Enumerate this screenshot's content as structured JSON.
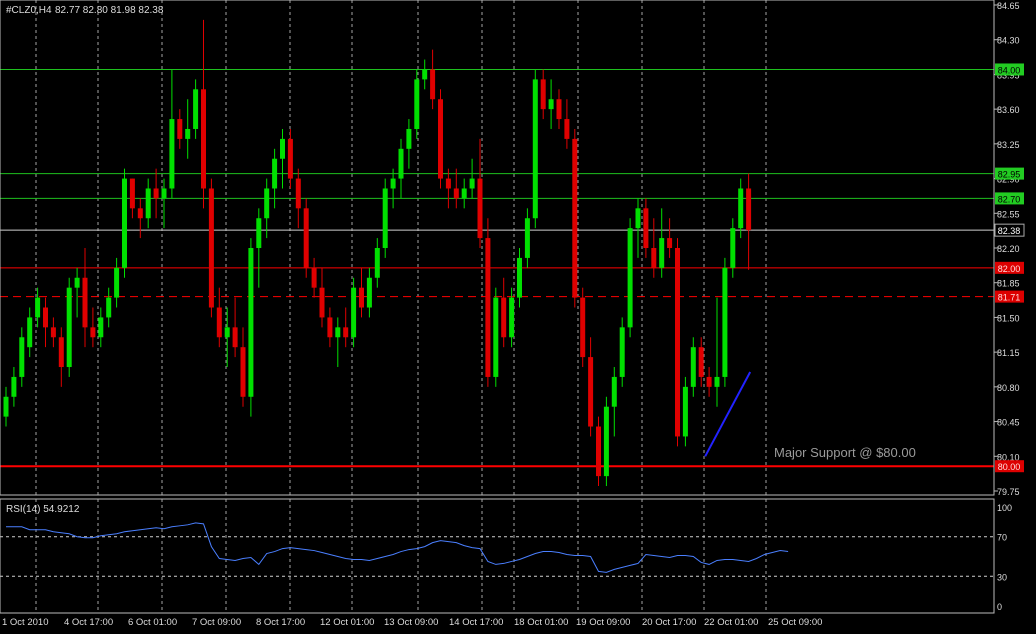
{
  "header": {
    "symbol": "#CLZ0,H4",
    "ohlc": "82.77 82.80 81.98 82.38"
  },
  "rsi": {
    "label": "RSI(14) 54.9212",
    "levels": [
      70,
      30
    ],
    "scale_labels": [
      "100",
      "70",
      "30",
      "0"
    ],
    "ylim": [
      0,
      100
    ]
  },
  "annotation": {
    "text": "Major Support @ $80.00"
  },
  "colors": {
    "background": "#000000",
    "bull": "#00e000",
    "bear": "#e00000",
    "grid": "#cfcfcf",
    "axis_text": "#dddddd",
    "support_line": "#ff0000",
    "resistance_line": "#1ec01e",
    "current_price_line": "#d0d0d0",
    "rsi_line": "#4a7fff",
    "trend_line": "#2222ff",
    "annotation_text": "#9a9a9a"
  },
  "chart_data": {
    "type": "candlestick",
    "title": "#CLZ0,H4",
    "ylim": [
      79.62,
      84.7
    ],
    "y_ticks": [
      "84.65",
      "84.30",
      "83.95",
      "83.60",
      "83.25",
      "82.90",
      "82.55",
      "82.20",
      "81.85",
      "81.50",
      "81.15",
      "80.80",
      "80.45",
      "80.10",
      "79.75"
    ],
    "x_ticks": [
      "1 Oct 2010",
      "4 Oct 17:00",
      "6 Oct 01:00",
      "7 Oct 09:00",
      "8 Oct 17:00",
      "12 Oct 01:00",
      "13 Oct 09:00",
      "14 Oct 17:00",
      "18 Oct 01:00",
      "19 Oct 09:00",
      "20 Oct 17:00",
      "22 Oct 01:00",
      "25 Oct 09:00"
    ],
    "grid": "vertical dashed",
    "horizontal_levels": [
      {
        "price": 84.0,
        "label": "84.00",
        "kind": "resistance",
        "style": "solid"
      },
      {
        "price": 82.95,
        "label": "82.95",
        "kind": "resistance",
        "style": "solid"
      },
      {
        "price": 82.7,
        "label": "82.70",
        "kind": "resistance",
        "style": "solid"
      },
      {
        "price": 82.38,
        "label": "82.38",
        "kind": "current",
        "style": "solid"
      },
      {
        "price": 82.0,
        "label": "82.00",
        "kind": "support",
        "style": "solid"
      },
      {
        "price": 81.71,
        "label": "81.71",
        "kind": "support",
        "style": "dashed"
      },
      {
        "price": 80.0,
        "label": "80.00",
        "kind": "major_support",
        "style": "solid"
      }
    ],
    "candles": [
      [
        80.5,
        80.8,
        80.4,
        80.7
      ],
      [
        80.7,
        81.0,
        80.6,
        80.9
      ],
      [
        80.9,
        81.4,
        80.8,
        81.3
      ],
      [
        81.2,
        81.6,
        81.1,
        81.5
      ],
      [
        81.5,
        81.8,
        81.4,
        81.7
      ],
      [
        81.6,
        81.7,
        81.2,
        81.4
      ],
      [
        81.4,
        81.5,
        81.2,
        81.3
      ],
      [
        81.3,
        81.4,
        80.8,
        81.0
      ],
      [
        81.0,
        81.9,
        80.9,
        81.8
      ],
      [
        81.8,
        82.0,
        81.5,
        81.9
      ],
      [
        81.9,
        82.2,
        81.2,
        81.4
      ],
      [
        81.4,
        81.6,
        81.2,
        81.3
      ],
      [
        81.3,
        81.6,
        81.2,
        81.5
      ],
      [
        81.5,
        81.8,
        81.4,
        81.7
      ],
      [
        81.7,
        82.1,
        81.6,
        82.0
      ],
      [
        82.0,
        83.0,
        81.9,
        82.9
      ],
      [
        82.9,
        82.9,
        82.5,
        82.6
      ],
      [
        82.6,
        82.7,
        82.3,
        82.5
      ],
      [
        82.5,
        82.9,
        82.4,
        82.8
      ],
      [
        82.8,
        83.0,
        82.5,
        82.7
      ],
      [
        82.7,
        82.9,
        82.4,
        82.8
      ],
      [
        82.8,
        84.0,
        82.7,
        83.5
      ],
      [
        83.5,
        83.6,
        83.2,
        83.3
      ],
      [
        83.3,
        83.7,
        83.1,
        83.4
      ],
      [
        83.4,
        83.9,
        83.3,
        83.8
      ],
      [
        83.8,
        84.5,
        82.6,
        82.8
      ],
      [
        82.8,
        82.9,
        81.5,
        81.6
      ],
      [
        81.6,
        81.8,
        81.2,
        81.3
      ],
      [
        81.3,
        81.6,
        81.0,
        81.4
      ],
      [
        81.4,
        81.7,
        81.1,
        81.2
      ],
      [
        81.2,
        81.4,
        80.6,
        80.7
      ],
      [
        80.7,
        82.3,
        80.5,
        82.2
      ],
      [
        82.2,
        82.6,
        81.8,
        82.5
      ],
      [
        82.5,
        82.9,
        82.3,
        82.8
      ],
      [
        82.8,
        83.2,
        82.6,
        83.1
      ],
      [
        83.1,
        83.4,
        82.8,
        83.3
      ],
      [
        83.3,
        83.4,
        82.8,
        82.9
      ],
      [
        82.9,
        83.0,
        82.4,
        82.6
      ],
      [
        82.6,
        82.7,
        81.9,
        82.0
      ],
      [
        82.0,
        82.1,
        81.7,
        81.8
      ],
      [
        81.8,
        82.0,
        81.4,
        81.5
      ],
      [
        81.5,
        81.6,
        81.2,
        81.3
      ],
      [
        81.3,
        81.5,
        81.0,
        81.4
      ],
      [
        81.4,
        81.6,
        81.2,
        81.3
      ],
      [
        81.3,
        81.9,
        81.2,
        81.8
      ],
      [
        81.8,
        82.0,
        81.5,
        81.6
      ],
      [
        81.6,
        82.0,
        81.5,
        81.9
      ],
      [
        81.9,
        82.3,
        81.8,
        82.2
      ],
      [
        82.2,
        82.9,
        82.1,
        82.8
      ],
      [
        82.8,
        83.0,
        82.6,
        82.9
      ],
      [
        82.9,
        83.3,
        82.7,
        83.2
      ],
      [
        83.2,
        83.5,
        83.0,
        83.4
      ],
      [
        83.4,
        84.0,
        83.3,
        83.9
      ],
      [
        83.9,
        84.1,
        83.8,
        84.0
      ],
      [
        84.0,
        84.2,
        83.6,
        83.7
      ],
      [
        83.7,
        83.8,
        82.8,
        82.9
      ],
      [
        82.9,
        83.0,
        82.6,
        82.8
      ],
      [
        82.8,
        83.0,
        82.6,
        82.7
      ],
      [
        82.7,
        82.9,
        82.6,
        82.8
      ],
      [
        82.8,
        83.1,
        82.7,
        82.9
      ],
      [
        82.9,
        83.3,
        82.2,
        82.3
      ],
      [
        82.3,
        82.5,
        80.8,
        80.9
      ],
      [
        80.9,
        81.8,
        80.8,
        81.7
      ],
      [
        81.7,
        81.9,
        81.2,
        81.3
      ],
      [
        81.3,
        81.8,
        81.2,
        81.7
      ],
      [
        81.7,
        82.2,
        81.6,
        82.1
      ],
      [
        82.1,
        82.6,
        82.0,
        82.5
      ],
      [
        82.5,
        84.0,
        82.4,
        83.9
      ],
      [
        83.9,
        84.0,
        83.5,
        83.6
      ],
      [
        83.6,
        83.9,
        83.4,
        83.7
      ],
      [
        83.7,
        83.8,
        83.4,
        83.5
      ],
      [
        83.5,
        83.7,
        83.2,
        83.3
      ],
      [
        83.3,
        83.4,
        81.6,
        81.7
      ],
      [
        81.7,
        81.8,
        81.0,
        81.1
      ],
      [
        81.1,
        81.3,
        80.3,
        80.4
      ],
      [
        80.4,
        80.5,
        79.8,
        79.9
      ],
      [
        79.9,
        80.7,
        79.8,
        80.6
      ],
      [
        80.6,
        81.0,
        80.3,
        80.9
      ],
      [
        80.9,
        81.5,
        80.8,
        81.4
      ],
      [
        81.4,
        82.5,
        81.3,
        82.4
      ],
      [
        82.4,
        82.7,
        82.1,
        82.6
      ],
      [
        82.6,
        82.7,
        82.1,
        82.2
      ],
      [
        82.2,
        82.5,
        81.9,
        82.0
      ],
      [
        82.0,
        82.6,
        81.9,
        82.3
      ],
      [
        82.3,
        82.5,
        82.1,
        82.2
      ],
      [
        82.2,
        82.3,
        80.2,
        80.3
      ],
      [
        80.3,
        80.9,
        80.2,
        80.8
      ],
      [
        80.8,
        81.3,
        80.7,
        81.2
      ],
      [
        81.2,
        81.3,
        80.8,
        80.9
      ],
      [
        80.9,
        81.0,
        80.7,
        80.8
      ],
      [
        80.8,
        81.7,
        80.6,
        80.9
      ],
      [
        80.9,
        82.1,
        80.8,
        82.0
      ],
      [
        82.0,
        82.5,
        81.9,
        82.4
      ],
      [
        82.4,
        82.9,
        82.3,
        82.8
      ],
      [
        82.8,
        82.95,
        81.98,
        82.38
      ]
    ],
    "rsi_values": [
      80,
      80,
      80,
      77,
      77,
      77,
      75,
      74,
      73,
      70,
      69,
      69,
      71,
      72,
      73,
      75,
      76,
      77,
      78,
      79,
      78,
      80,
      81,
      82,
      84,
      83,
      60,
      48,
      47,
      46,
      48,
      49,
      42,
      53,
      55,
      58,
      59,
      58,
      57,
      56,
      54,
      52,
      50,
      48,
      47,
      47,
      46,
      48,
      50,
      52,
      55,
      57,
      58,
      60,
      64,
      66,
      65,
      64,
      61,
      59,
      58,
      45,
      42,
      43,
      45,
      47,
      50,
      53,
      55,
      55,
      54,
      52,
      51,
      51,
      50,
      35,
      34,
      37,
      39,
      41,
      43,
      52,
      51,
      50,
      49,
      51,
      51,
      50,
      44,
      42,
      46,
      47,
      47,
      46,
      45,
      48,
      52,
      54,
      56,
      55
    ]
  }
}
